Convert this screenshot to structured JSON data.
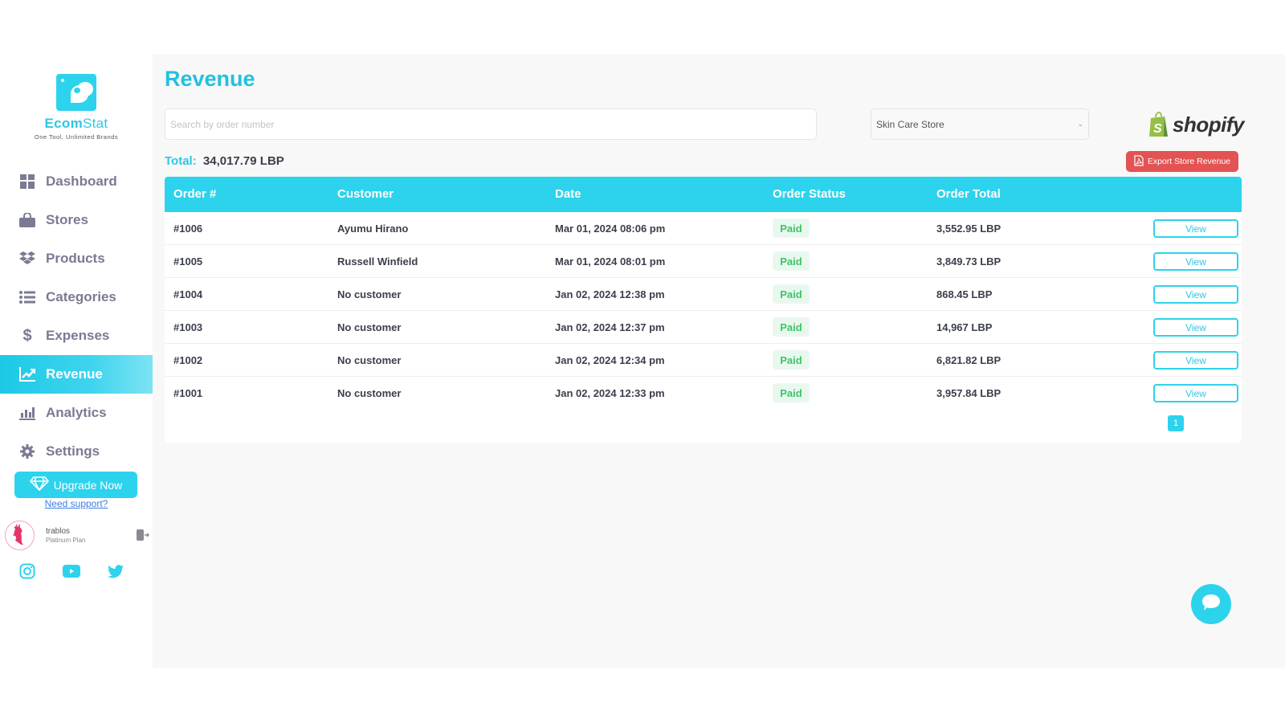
{
  "brand": {
    "name_bold": "Ecom",
    "name_light": "Stat",
    "tagline": "One Tool, Unlimited Brands"
  },
  "sidebar": {
    "items": [
      {
        "label": "Dashboard",
        "icon": "dashboard-grid-icon",
        "active": false
      },
      {
        "label": "Stores",
        "icon": "shopping-bag-icon",
        "active": false
      },
      {
        "label": "Products",
        "icon": "dropbox-box-icon",
        "active": false
      },
      {
        "label": "Categories",
        "icon": "list-icon",
        "active": false
      },
      {
        "label": "Expenses",
        "icon": "dollar-icon",
        "active": false
      },
      {
        "label": "Revenue",
        "icon": "trend-chart-icon",
        "active": true
      },
      {
        "label": "Analytics",
        "icon": "bar-chart-icon",
        "active": false
      },
      {
        "label": "Settings",
        "icon": "gear-icon",
        "active": false
      }
    ],
    "upgrade_label": "Upgrade Now",
    "support_label": "Need support?",
    "user": {
      "name": "trablos",
      "plan": "Platinum Plan"
    },
    "social": [
      "instagram-icon",
      "youtube-icon",
      "twitter-icon"
    ]
  },
  "header": {
    "title": "Revenue",
    "search_placeholder": "Search by order number",
    "search_value": "",
    "store_selected": "Skin Care Store",
    "platform": "shopify"
  },
  "summary": {
    "total_label": "Total:",
    "total_value": "34,017.79 LBP",
    "export_label": "Export Store Revenue"
  },
  "colors": {
    "accent": "#2dd3ec",
    "danger": "#e35353",
    "paid_text": "#3cc467",
    "paid_bg": "#e9f8ef"
  },
  "table": {
    "columns": [
      "Order #",
      "Customer",
      "Date",
      "Order Status",
      "Order Total",
      ""
    ],
    "rows": [
      {
        "order": "#1006",
        "customer": "Ayumu Hirano",
        "date": "Mar 01, 2024 08:06 pm",
        "status": "Paid",
        "total": "3,552.95 LBP",
        "action": "View"
      },
      {
        "order": "#1005",
        "customer": "Russell Winfield",
        "date": "Mar 01, 2024 08:01 pm",
        "status": "Paid",
        "total": "3,849.73 LBP",
        "action": "View"
      },
      {
        "order": "#1004",
        "customer": "No customer",
        "date": "Jan 02, 2024 12:38 pm",
        "status": "Paid",
        "total": "868.45 LBP",
        "action": "View"
      },
      {
        "order": "#1003",
        "customer": "No customer",
        "date": "Jan 02, 2024 12:37 pm",
        "status": "Paid",
        "total": "14,967 LBP",
        "action": "View"
      },
      {
        "order": "#1002",
        "customer": "No customer",
        "date": "Jan 02, 2024 12:34 pm",
        "status": "Paid",
        "total": "6,821.82 LBP",
        "action": "View"
      },
      {
        "order": "#1001",
        "customer": "No customer",
        "date": "Jan 02, 2024 12:33 pm",
        "status": "Paid",
        "total": "3,957.84 LBP",
        "action": "View"
      }
    ],
    "pagination": {
      "current_page": "1"
    }
  }
}
